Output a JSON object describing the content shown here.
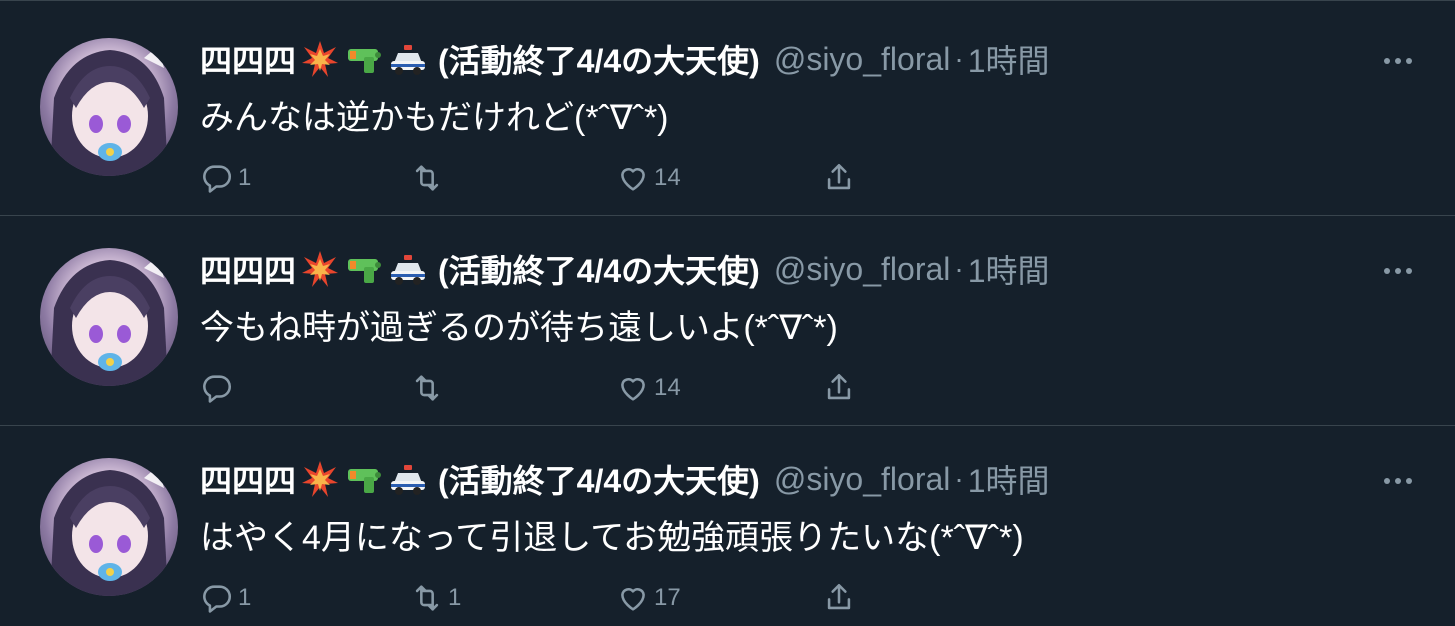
{
  "colors": {
    "background": "#15202b",
    "divider": "#38444d",
    "text_primary": "#ffffff",
    "text_secondary": "#8899a6"
  },
  "tweets": [
    {
      "display_name": "四四四",
      "badges": [
        "collision-icon",
        "water-pistol-icon",
        "police-car-icon"
      ],
      "name_suffix": "(活動終了4/4の大天使)",
      "handle": "@siyo_floral",
      "separator": "·",
      "time": "1時間",
      "text": "みんなは逆かもだけれど(*ˆ∇ˆ*)",
      "replies": "1",
      "retweets": "",
      "likes": "14"
    },
    {
      "display_name": "四四四",
      "badges": [
        "collision-icon",
        "water-pistol-icon",
        "police-car-icon"
      ],
      "name_suffix": "(活動終了4/4の大天使)",
      "handle": "@siyo_floral",
      "separator": "·",
      "time": "1時間",
      "text": "今もね時が過ぎるのが待ち遠しいよ(*ˆ∇ˆ*)",
      "replies": "",
      "retweets": "",
      "likes": "14"
    },
    {
      "display_name": "四四四",
      "badges": [
        "collision-icon",
        "water-pistol-icon",
        "police-car-icon"
      ],
      "name_suffix": "(活動終了4/4の大天使)",
      "handle": "@siyo_floral",
      "separator": "·",
      "time": "1時間",
      "text": "はやく4月になって引退してお勉強頑張りたいな(*ˆ∇ˆ*)",
      "replies": "1",
      "retweets": "1",
      "likes": "17"
    }
  ]
}
